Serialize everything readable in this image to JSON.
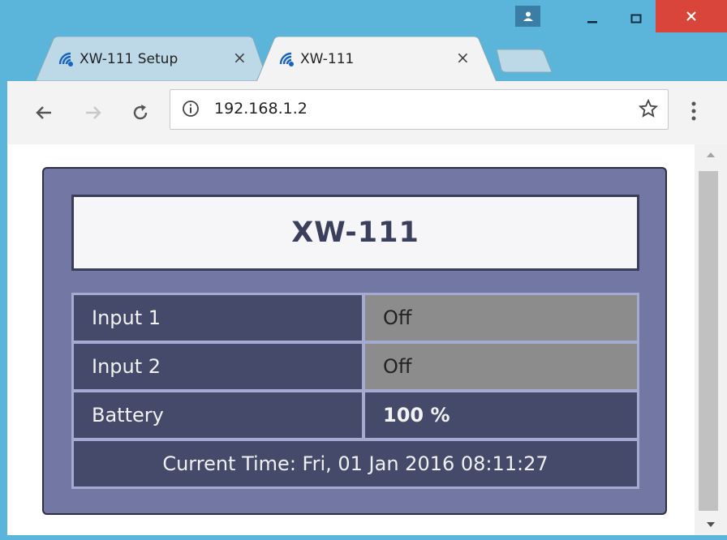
{
  "browser": {
    "tabs": [
      {
        "title": "XW-111 Setup",
        "close": "×",
        "active": false
      },
      {
        "title": "XW-111",
        "close": "×",
        "active": true
      }
    ],
    "url": "192.168.1.2",
    "icons": [
      "back-arrow-icon",
      "forward-arrow-icon",
      "reload-icon",
      "info-icon",
      "star-icon",
      "kebab-menu-icon",
      "wifi-icon",
      "user-icon",
      "minimize-icon",
      "maximize-icon",
      "close-icon"
    ]
  },
  "device": {
    "name": "XW-111",
    "rows": [
      {
        "label": "Input 1",
        "value": "Off"
      },
      {
        "label": "Input 2",
        "value": "Off"
      },
      {
        "label": "Battery",
        "value": "100 %"
      }
    ],
    "current_time": "Current Time: Fri, 01 Jan 2016 08:11:27"
  },
  "colors": {
    "panel": "#7278a3",
    "cell_dark": "#454a6b",
    "cell_off": "#8c8c8c",
    "close_button": "#d9453b"
  }
}
